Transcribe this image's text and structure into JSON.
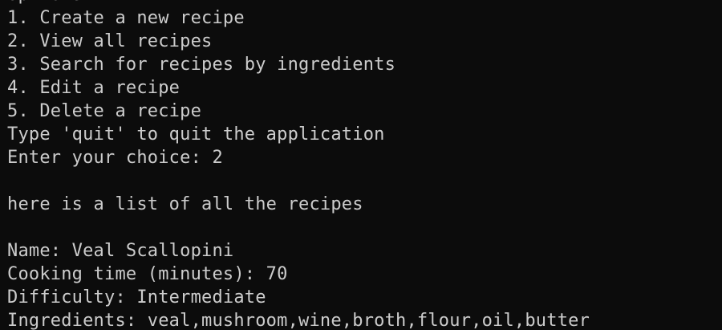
{
  "colors": {
    "background": "#0c0c0c",
    "foreground": "#cccccc"
  },
  "terminal": {
    "lines": [
      "Options:",
      "1. Create a new recipe",
      "2. View all recipes",
      "3. Search for recipes by ingredients",
      "4. Edit a recipe",
      "5. Delete a recipe",
      "Type 'quit' to quit the application",
      "Enter your choice: 2",
      "",
      "here is a list of all the recipes",
      "",
      "Name: Veal Scallopini",
      "Cooking time (minutes): 70",
      "Difficulty: Intermediate",
      "Ingredients: veal,mushroom,wine,broth,flour,oil,butter"
    ]
  }
}
